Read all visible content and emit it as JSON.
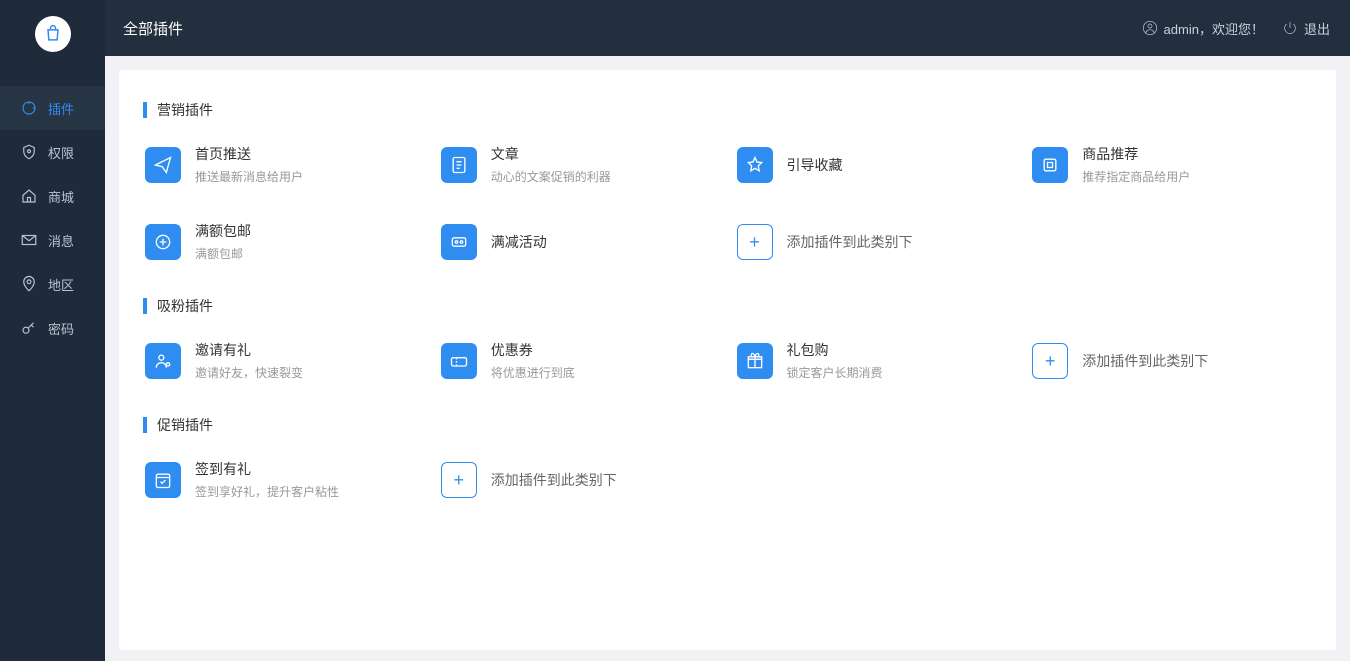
{
  "header": {
    "title": "全部插件",
    "user_prefix": "admin",
    "welcome": "，欢迎您！",
    "logout": "退出"
  },
  "sidebar": {
    "items": [
      {
        "label": "插件",
        "icon": "refresh"
      },
      {
        "label": "权限",
        "icon": "shield"
      },
      {
        "label": "商城",
        "icon": "home"
      },
      {
        "label": "消息",
        "icon": "mail"
      },
      {
        "label": "地区",
        "icon": "pin"
      },
      {
        "label": "密码",
        "icon": "key"
      }
    ]
  },
  "sections": [
    {
      "title": "营销插件",
      "plugins": [
        {
          "name": "首页推送",
          "desc": "推送最新消息给用户",
          "icon": "send"
        },
        {
          "name": "文章",
          "desc": "动心的文案促销的利器",
          "icon": "doc"
        },
        {
          "name": "引导收藏",
          "desc": "",
          "icon": "star"
        },
        {
          "name": "商品推荐",
          "desc": "推荐指定商品给用户",
          "icon": "reco"
        },
        {
          "name": "满额包邮",
          "desc": "满额包邮",
          "icon": "ship"
        },
        {
          "name": "满减活动",
          "desc": "",
          "icon": "discount"
        },
        {
          "add": true,
          "name": "添加插件到此类别下"
        }
      ]
    },
    {
      "title": "吸粉插件",
      "plugins": [
        {
          "name": "邀请有礼",
          "desc": "邀请好友，快速裂变",
          "icon": "invite"
        },
        {
          "name": "优惠券",
          "desc": "将优惠进行到底",
          "icon": "coupon"
        },
        {
          "name": "礼包购",
          "desc": "锁定客户长期消费",
          "icon": "gift"
        },
        {
          "add": true,
          "name": "添加插件到此类别下"
        }
      ]
    },
    {
      "title": "促销插件",
      "plugins": [
        {
          "name": "签到有礼",
          "desc": "签到享好礼，提升客户粘性",
          "icon": "checkin"
        },
        {
          "add": true,
          "name": "添加插件到此类别下"
        }
      ]
    }
  ]
}
